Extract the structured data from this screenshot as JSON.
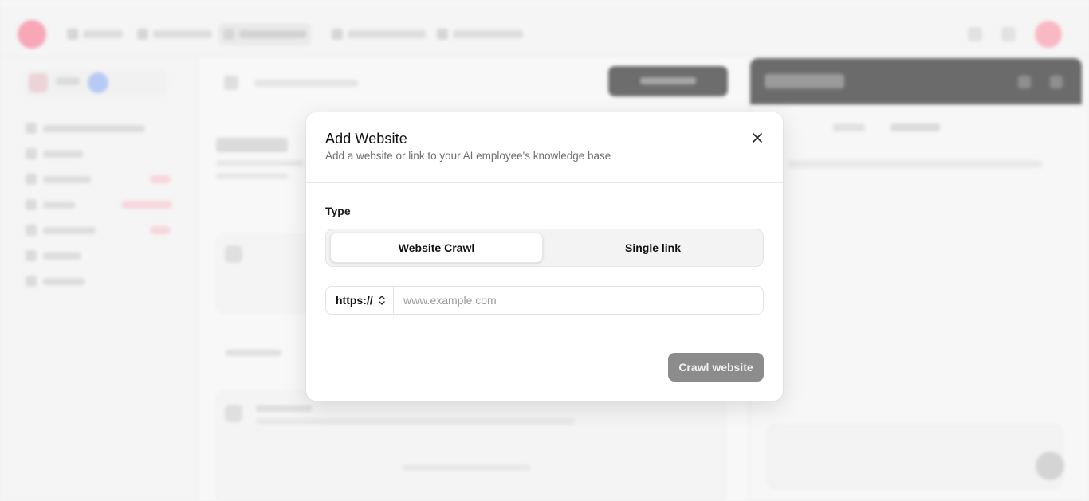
{
  "modal": {
    "title": "Add Website",
    "subtitle": "Add a website or link to your AI employee's knowledge base",
    "close_icon": "close-icon",
    "type_label": "Type",
    "type_options": [
      {
        "label": "Website Crawl",
        "selected": true
      },
      {
        "label": "Single link",
        "selected": false
      }
    ],
    "protocol": {
      "value": "https://",
      "icon": "chevron-up-down-icon"
    },
    "url_input": {
      "value": "",
      "placeholder": "www.example.com"
    },
    "submit_label": "Crawl website",
    "submit_color": "#8c8c8c"
  },
  "colors": {
    "accent": "#f58aa0",
    "overlay": "rgba(255,255,255,0.25)"
  }
}
